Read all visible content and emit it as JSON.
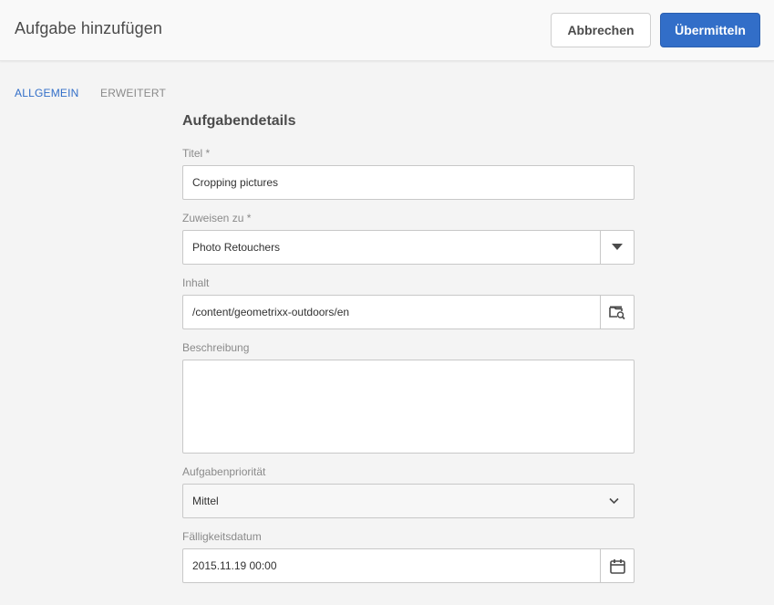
{
  "header": {
    "title": "Aufgabe hinzufügen",
    "cancel_label": "Abbrechen",
    "submit_label": "Übermitteln"
  },
  "tabs": [
    {
      "label": "ALLGEMEIN",
      "active": true
    },
    {
      "label": "ERWEITERT",
      "active": false
    }
  ],
  "form": {
    "section_title": "Aufgabendetails",
    "title_field": {
      "label": "Titel *",
      "value": "Cropping pictures"
    },
    "assign_field": {
      "label": "Zuweisen zu *",
      "value": "Photo Retouchers",
      "icon": "triangle-down-icon"
    },
    "content_field": {
      "label": "Inhalt",
      "value": "/content/geometrixx-outdoors/en",
      "icon": "folder-search-icon"
    },
    "description_field": {
      "label": "Beschreibung",
      "value": ""
    },
    "priority_field": {
      "label": "Aufgabenpriorität",
      "value": "Mittel",
      "icon": "chevron-down-icon"
    },
    "due_date_field": {
      "label": "Fälligkeitsdatum",
      "value": "2015.11.19 00:00",
      "icon": "calendar-icon"
    }
  },
  "colors": {
    "accent": "#326ec8",
    "background": "#f4f4f4",
    "header_bg": "#f9f9f9"
  }
}
